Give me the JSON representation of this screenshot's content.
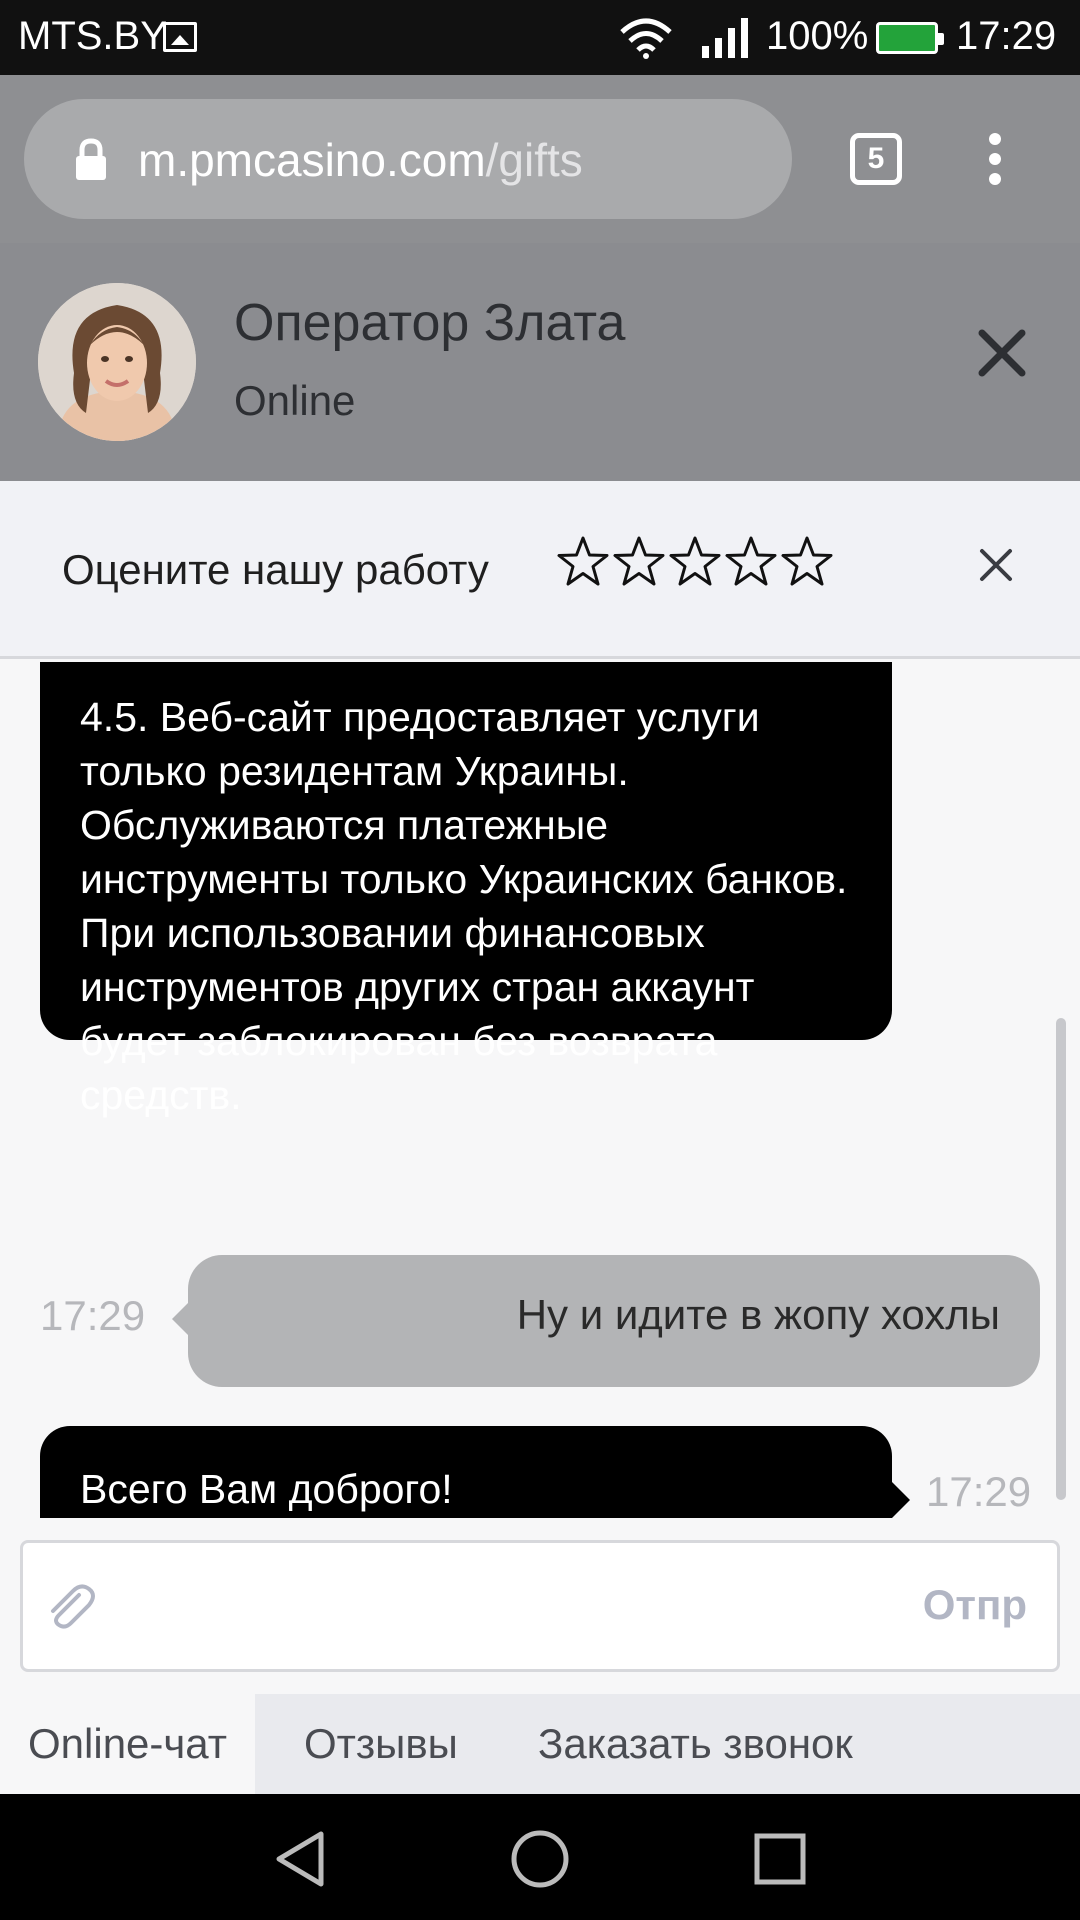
{
  "status_bar": {
    "carrier": "MTS.BY",
    "battery_percent": "100%",
    "time": "17:29",
    "icons": [
      "image-icon",
      "wifi-icon",
      "signal-icon",
      "battery-icon"
    ]
  },
  "browser": {
    "url_host": "m.pmcasino.com",
    "url_path": "/gifts",
    "tabs_count": "5",
    "icons": [
      "lock-icon",
      "menu-dots-icon"
    ]
  },
  "operator": {
    "name": "Оператор Злата",
    "status": "Online"
  },
  "rating": {
    "label": "Оцените нашу работу",
    "max_stars": 5,
    "selected_stars": 0
  },
  "chat": {
    "messages": [
      {
        "sender": "operator",
        "text": "4.5. Веб-сайт предоставляет услуги только резидентам Украины. Обслуживаются платежные инструменты только Украинских банков. При использовании финансовых инструментов других стран аккаунт будет заблокирован без возврата средств."
      },
      {
        "sender": "user",
        "time": "17:29",
        "text": "Ну и идите в жопу хохлы"
      },
      {
        "sender": "operator",
        "time": "17:29",
        "text": "Всего Вам доброго!"
      }
    ]
  },
  "composer": {
    "placeholder": "",
    "send_label": "Отпр"
  },
  "tabs": [
    {
      "label": "Online-чат",
      "active": true
    },
    {
      "label": "Отзывы",
      "active": false
    },
    {
      "label": "Заказать звонок",
      "active": false
    }
  ],
  "colors": {
    "header_gray": "#8b8c90",
    "operator_bubble": "#000000",
    "user_bubble": "#b3b4b6",
    "battery_green": "#23a33a"
  }
}
